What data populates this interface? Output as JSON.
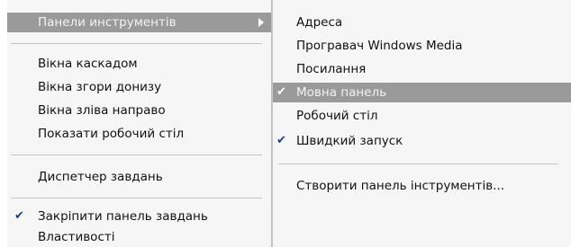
{
  "main_menu": {
    "toolbars_item": "Панели инструментів",
    "cascade": "Вікна каскадом",
    "stack": "Вікна згори донизу",
    "side_by_side": "Вікна зліва направо",
    "show_desktop": "Показати робочий стіл",
    "task_manager": "Диспетчер завдань",
    "lock_taskbar": "Закріпити панель завдань",
    "properties": "Властивості"
  },
  "toolbars_submenu": {
    "address": "Адреса",
    "media_player": "Програвач  Windows Media",
    "links": "Посилання",
    "language_bar": "Мовна панель",
    "desktop": "Робочий стіл",
    "quick_launch": "Швидкий запуск",
    "new_toolbar": "Створити панель інструментів..."
  },
  "check_glyph": "✔",
  "colors": {
    "menu_background": "#f6f6f6",
    "highlight": "#9a9a9a",
    "highlight_text": "#f3f3f3",
    "check_mark": "#1e3c8c"
  }
}
